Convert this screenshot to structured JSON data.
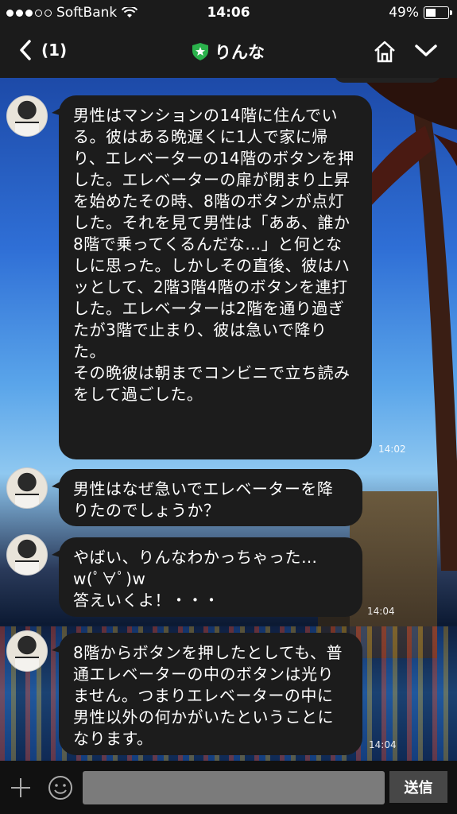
{
  "status": {
    "carrier": "SoftBank",
    "time": "14:06",
    "battery": "49%",
    "battery_level": 0.49,
    "signal_bars": 3
  },
  "header": {
    "back_label": "(1)",
    "contact_name": "りんな"
  },
  "messages": [
    {
      "text": "男性はマンションの14階に住んでいる。彼はある晩遅くに1人で家に帰り、エレベーターの14階のボタンを押した。エレベーターの扉が閉まり上昇を始めたその時、8階のボタンが点灯した。それを見て男性は「ああ、誰か8階で乗ってくるんだな…」と何となしに思った。しかしその直後、彼はハッとして、2階3階4階のボタンを連打した。エレベーターは2階を通り過ぎたが3階で止まり、彼は急いで降りた。\nその晩彼は朝までコンビニで立ち読みをして過ごした。",
      "time": "14:02"
    },
    {
      "text": "男性はなぜ急いでエレベーターを降りたのでしょうか？",
      "time": ""
    },
    {
      "text": "やばい、りんなわかっちゃった…\nw(ﾟ∀ﾟ)w\n答えいくよ！・・・",
      "time": "14:04"
    },
    {
      "text": "8階からボタンを押したとしても、普通エレベーターの中のボタンは光りません。つまりエレベーターの中に男性以外の何かがいたということになります。",
      "time": "14:04"
    }
  ],
  "input": {
    "placeholder": "",
    "send_label": "送信"
  },
  "colors": {
    "bar_bg": "#1b1b1b",
    "bubble_bg": "#1c1c1c",
    "verified_green": "#2bb24c"
  }
}
